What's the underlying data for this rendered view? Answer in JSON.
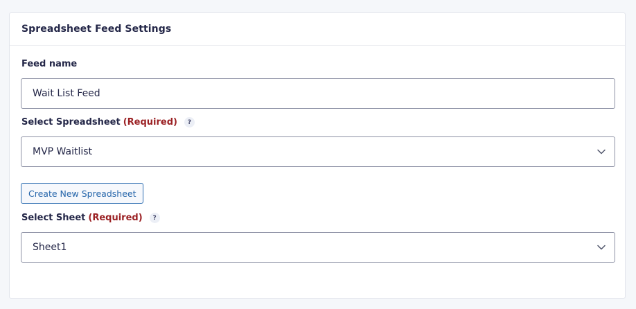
{
  "panel": {
    "title": "Spreadsheet Feed Settings"
  },
  "feed_name": {
    "label": "Feed name",
    "value": "Wait List Feed"
  },
  "spreadsheet": {
    "label": "Select Spreadsheet",
    "required": "(Required)",
    "help": "?",
    "selected": "MVP Waitlist",
    "icon": "chevron-down-icon"
  },
  "create_button": {
    "label": "Create New Spreadsheet"
  },
  "sheet": {
    "label": "Select Sheet",
    "required": "(Required)",
    "help": "?",
    "selected": "Sheet1",
    "icon": "chevron-down-icon"
  },
  "colors": {
    "required": "#9b2124",
    "button_accent": "#2565aa",
    "border": "#8b8fa3"
  }
}
